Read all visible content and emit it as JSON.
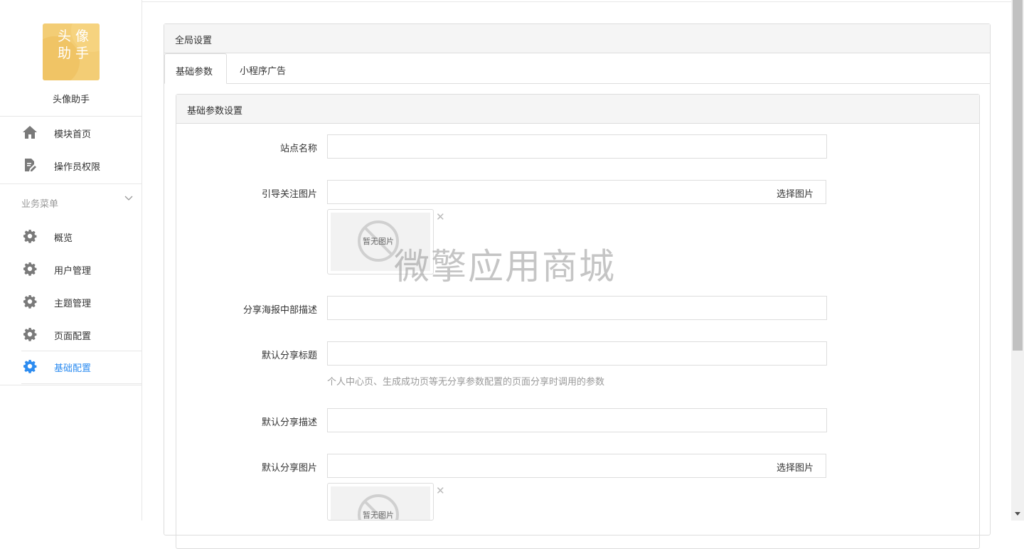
{
  "sidebar": {
    "logo_text": "头像助手",
    "app_name": "头像助手",
    "top_items": [
      {
        "label": "模块首页",
        "icon": "home-icon"
      },
      {
        "label": "操作员权限",
        "icon": "edit-document-icon"
      }
    ],
    "group_title": "业务菜单",
    "group_items": [
      {
        "label": "概览",
        "icon": "gear-icon"
      },
      {
        "label": "用户管理",
        "icon": "gear-icon"
      },
      {
        "label": "主题管理",
        "icon": "gear-icon"
      },
      {
        "label": "页面配置",
        "icon": "gear-icon"
      },
      {
        "label": "基础配置",
        "icon": "gear-icon",
        "active": true
      }
    ]
  },
  "panel": {
    "title": "全局设置",
    "tabs": [
      {
        "label": "基础参数",
        "active": true
      },
      {
        "label": "小程序广告"
      }
    ],
    "section_title": "基础参数设置"
  },
  "form": {
    "site_name": {
      "label": "站点名称",
      "value": ""
    },
    "follow_image": {
      "label": "引导关注图片",
      "value": "",
      "button": "选择图片",
      "placeholder_text": "暂无图片"
    },
    "poster_desc": {
      "label": "分享海报中部描述",
      "value": ""
    },
    "share_title": {
      "label": "默认分享标题",
      "value": "",
      "help": "个人中心页、生成成功页等无分享参数配置的页面分享时调用的参数"
    },
    "share_desc": {
      "label": "默认分享描述",
      "value": ""
    },
    "share_image": {
      "label": "默认分享图片",
      "value": "",
      "button": "选择图片",
      "placeholder_text": "暂无图片"
    }
  },
  "watermark": "微擎应用商城",
  "colors": {
    "accent": "#2d8cf0",
    "icon_gray": "#7a7a7a",
    "logo": "#f3cd75"
  }
}
